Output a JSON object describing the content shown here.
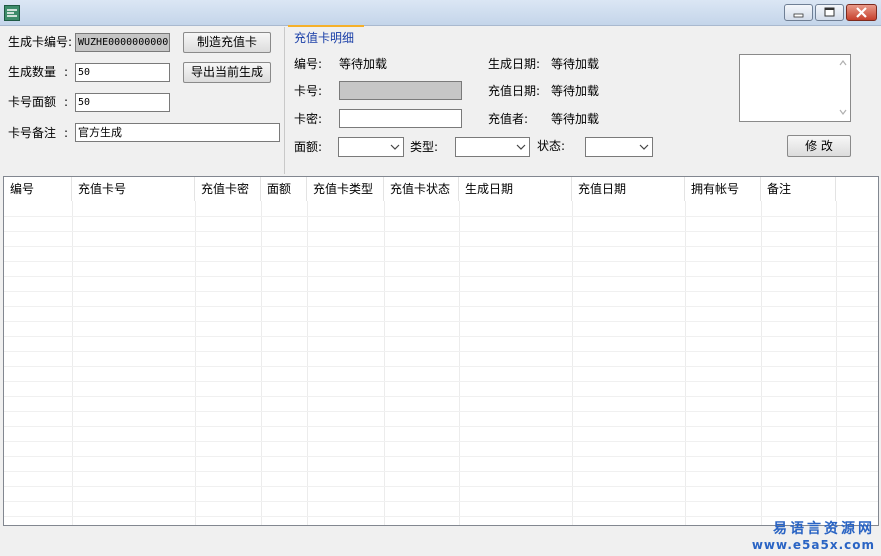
{
  "window": {
    "buttons": {
      "minimize": "minimize-icon",
      "restore": "restore-icon",
      "close": "close-icon"
    }
  },
  "left_panel": {
    "card_number_label": "生成卡编号:",
    "card_number_value": "WUZHE0000000000",
    "quantity_label": "生成数量",
    "quantity_colon": ":",
    "quantity_value": "50",
    "face_value_label": "卡号面额",
    "face_value_colon": ":",
    "face_value_value": "50",
    "remark_label": "卡号备注",
    "remark_colon": ":",
    "remark_value": "官方生成",
    "make_card_button": "制造充值卡",
    "export_button": "导出当前生成"
  },
  "detail": {
    "section_title": "充值卡明细",
    "number_label": "编号:",
    "number_value": "等待加载",
    "card_no_label": "卡号:",
    "password_label": "卡密:",
    "create_date_label": "生成日期:",
    "create_date_value": "等待加载",
    "recharge_date_label": "充值日期:",
    "recharge_date_value": "等待加载",
    "recharger_label": "充值者:",
    "recharger_value": "等待加载",
    "face_label": "面额:",
    "type_label": "类型:",
    "status_label": "状态:",
    "modify_button": "修 改"
  },
  "table": {
    "columns": [
      "编号",
      "充值卡号",
      "充值卡密",
      "面额",
      "充值卡类型",
      "充值卡状态",
      "生成日期",
      "充值日期",
      "拥有帐号",
      "备注"
    ],
    "rows": []
  },
  "watermark": {
    "line1": "易语言资源网",
    "line2": "www.e5a5x.com"
  }
}
